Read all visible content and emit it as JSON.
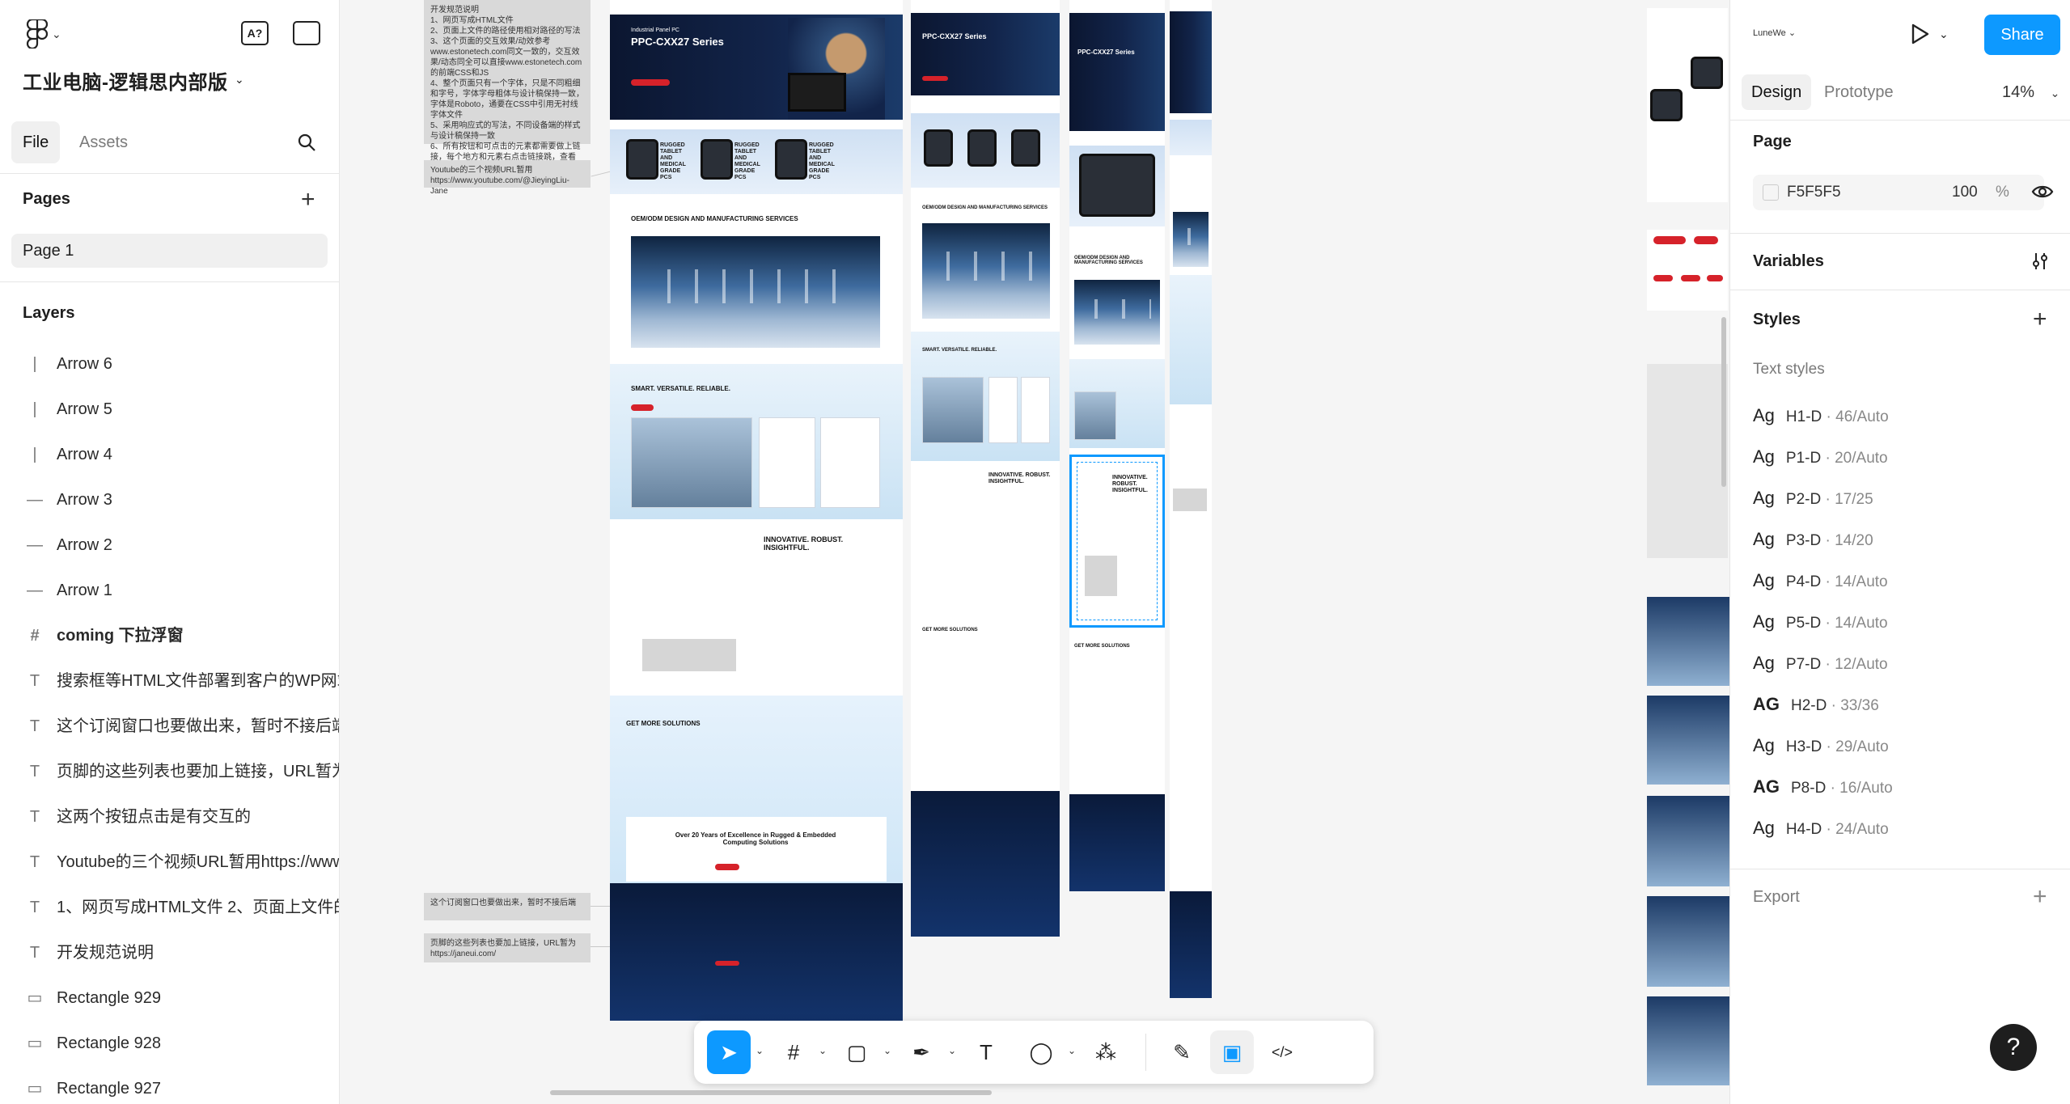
{
  "project": {
    "title": "工业电脑-逻辑思内部版"
  },
  "left_tabs": {
    "file": "File",
    "assets": "Assets"
  },
  "pages_section": {
    "title": "Pages",
    "items": [
      "Page 1"
    ]
  },
  "layers_section": {
    "title": "Layers",
    "items": [
      {
        "label": "Arrow 6",
        "icon": "arrow-icon"
      },
      {
        "label": "Arrow 5",
        "icon": "arrow-icon"
      },
      {
        "label": "Arrow 4",
        "icon": "arrow-icon"
      },
      {
        "label": "Arrow 3",
        "icon": "arrow-icon"
      },
      {
        "label": "Arrow 2",
        "icon": "arrow-icon"
      },
      {
        "label": "Arrow 1",
        "icon": "arrow-icon"
      },
      {
        "label": "coming 下拉浮窗",
        "icon": "frame-icon"
      },
      {
        "label": "搜索框等HTML文件部署到客户的WP网站",
        "icon": "text-icon"
      },
      {
        "label": "这个订阅窗口也要做出来，暂时不接后端",
        "icon": "text-icon"
      },
      {
        "label": "页脚的这些列表也要加上链接，URL暂为h",
        "icon": "text-icon"
      },
      {
        "label": "这两个按钮点击是有交互的",
        "icon": "text-icon"
      },
      {
        "label": "Youtube的三个视频URL暂用https://www",
        "icon": "text-icon"
      },
      {
        "label": "1、网页写成HTML文件 2、页面上文件的",
        "icon": "text-icon"
      },
      {
        "label": "开发规范说明",
        "icon": "text-icon"
      },
      {
        "label": "Rectangle 929",
        "icon": "rectangle-icon"
      },
      {
        "label": "Rectangle 928",
        "icon": "rectangle-icon"
      },
      {
        "label": "Rectangle 927",
        "icon": "rectangle-icon"
      }
    ]
  },
  "canvas": {
    "notes": {
      "dev_spec": "开发规范说明\n1、网页写成HTML文件\n2、页面上文件的路径使用相对路径的写法\n3、这个页面的交互效果/动效参考www.estonetech.com同文一致的，交互效果/动态同全可以直接www.estonetech.com的前端CSS和JS\n4、整个页面只有一个字体，只是不同粗细和字号，字体字母粗体与设计稿保持一致，字体是Roboto，通要在CSS中引用无衬线字体文件\n5、采用响应式的写法，不同设备端的样式与设计稿保持一致\n6、所有按钮和可点击的元素都需要做上链接，每个地方和元素右点击链接跳，查看estonetech.com\nURL暂为https://janeui.com/",
      "youtube": "Youtube的三个视频URL暂用https://www.youtube.com/@JieyingLiu-Jane",
      "subscribe": "这个订阅窗口也要做出来，暂时不接后端",
      "footer": "页脚的这些列表也要加上链接，URL暂为https://janeui.com/"
    },
    "page_headings": {
      "hero_tag": "Industrial Panel PC",
      "hero_title": "PPC-CXX27 Series",
      "tablet": "RUGGED TABLET AND MEDICAL GRADE PCS",
      "oem": "OEM/ODM DESIGN AND MANUFACTURING SERVICES",
      "smart": "SMART. VERSATILE. RELIABLE.",
      "innovative": "INNOVATIVE. ROBUST. INSIGHTFUL.",
      "solutions": "GET MORE SOLUTIONS",
      "excellence": "Over 20 Years of Excellence in Rugged & Embedded Computing Solutions"
    }
  },
  "toolbar": {
    "tools": [
      {
        "name": "move-tool",
        "icon": "cursor-icon",
        "glyph": "➤"
      },
      {
        "name": "frame-tool",
        "icon": "frame-icon",
        "glyph": "#"
      },
      {
        "name": "rectangle-tool",
        "icon": "rectangle-icon",
        "glyph": "▢"
      },
      {
        "name": "pen-tool",
        "icon": "pen-icon",
        "glyph": "✒"
      },
      {
        "name": "text-tool",
        "icon": "text-icon",
        "glyph": "T"
      },
      {
        "name": "comment-tool",
        "icon": "comment-icon",
        "glyph": "◯"
      },
      {
        "name": "actions-tool",
        "icon": "actions-icon",
        "glyph": "⁂"
      },
      {
        "name": "draw-tool",
        "icon": "draw-icon",
        "glyph": "✎"
      },
      {
        "name": "design-mode",
        "icon": "design-mode-icon",
        "glyph": "▣"
      },
      {
        "name": "dev-mode",
        "icon": "code-icon",
        "glyph": "</>"
      }
    ]
  },
  "right_panel": {
    "user": "LuneWe",
    "share_label": "Share",
    "tabs": {
      "design": "Design",
      "prototype": "Prototype"
    },
    "zoom": "14%",
    "page": {
      "title": "Page",
      "fill_hex": "F5F5F5",
      "opacity": "100",
      "percent": "%"
    },
    "variables": "Variables",
    "styles": "Styles",
    "text_styles_title": "Text styles",
    "text_styles": [
      {
        "ag": "Ag",
        "name": "H1-D",
        "detail": " · 46/Auto",
        "bold": false
      },
      {
        "ag": "Ag",
        "name": "P1-D",
        "detail": " · 20/Auto",
        "bold": false
      },
      {
        "ag": "Ag",
        "name": "P2-D",
        "detail": " · 17/25",
        "bold": false
      },
      {
        "ag": "Ag",
        "name": "P3-D",
        "detail": " · 14/20",
        "bold": false
      },
      {
        "ag": "Ag",
        "name": "P4-D",
        "detail": " · 14/Auto",
        "bold": false
      },
      {
        "ag": "Ag",
        "name": "P5-D",
        "detail": " · 14/Auto",
        "bold": false
      },
      {
        "ag": "Ag",
        "name": "P7-D",
        "detail": " · 12/Auto",
        "bold": false
      },
      {
        "ag": "AG",
        "name": "H2-D",
        "detail": " · 33/36",
        "bold": true
      },
      {
        "ag": "Ag",
        "name": "H3-D",
        "detail": " · 29/Auto",
        "bold": false
      },
      {
        "ag": "AG",
        "name": "P8-D",
        "detail": " · 16/Auto",
        "bold": true
      },
      {
        "ag": "Ag",
        "name": "H4-D",
        "detail": " · 24/Auto",
        "bold": false
      }
    ],
    "export": "Export"
  },
  "help_label": "?",
  "colors": {
    "accent": "#0d99ff",
    "brand_red": "#d6222a",
    "navy": "#0b1630"
  }
}
